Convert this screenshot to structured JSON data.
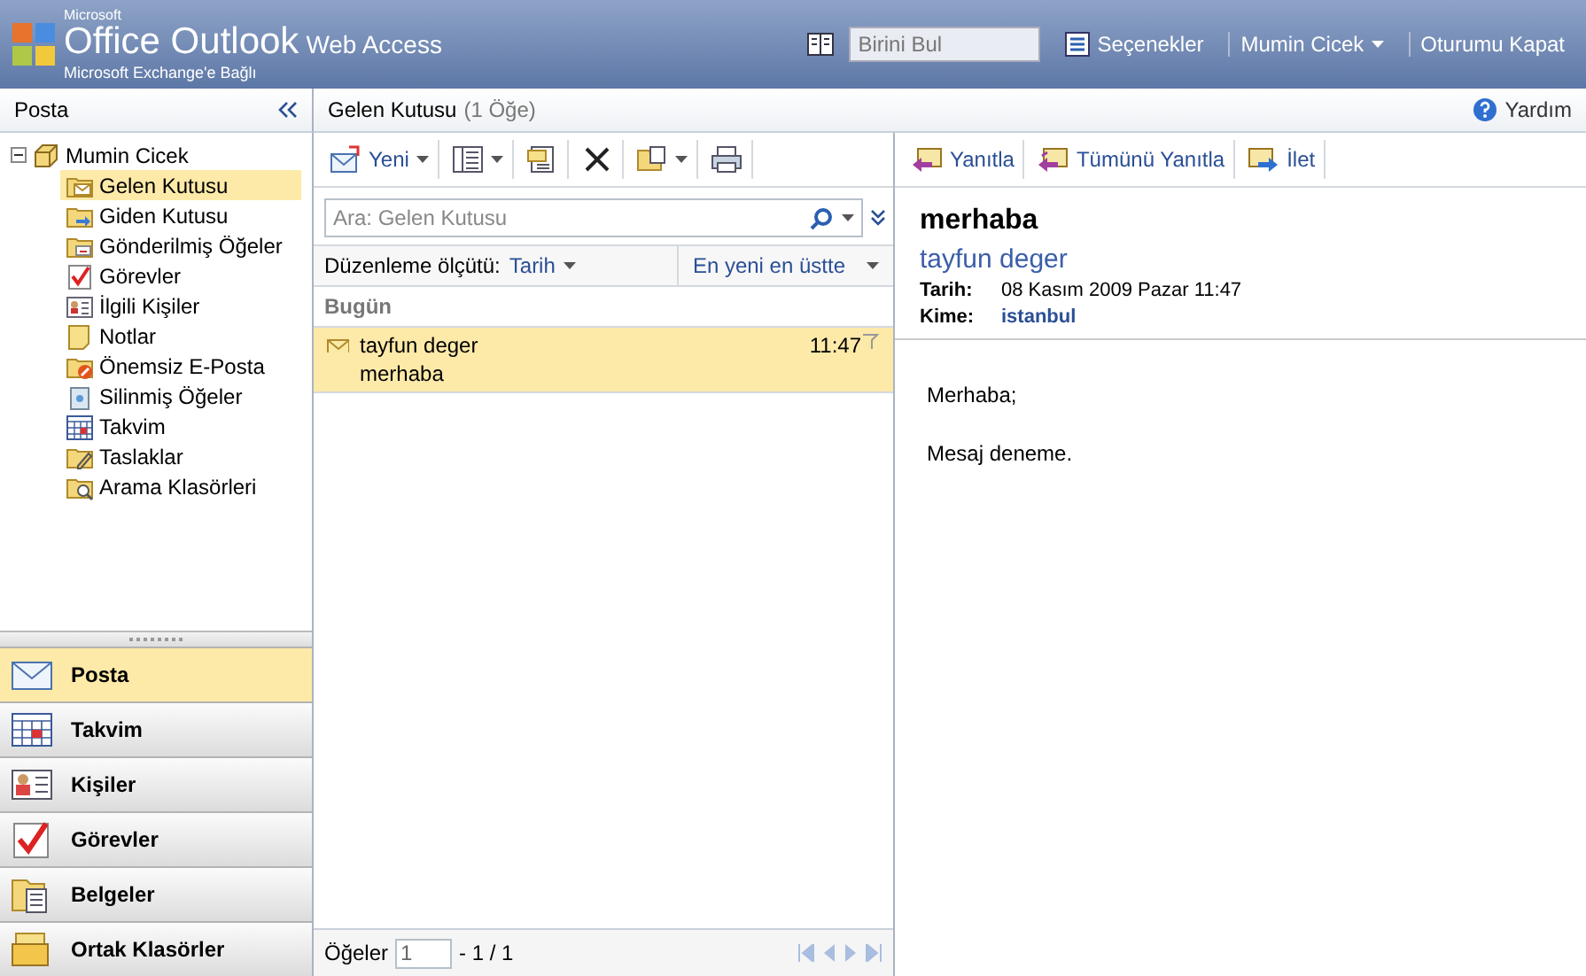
{
  "header": {
    "brand_small": "Microsoft",
    "brand": "Office Outlook",
    "brand_suffix": "Web Access",
    "subtitle": "Microsoft Exchange'e Bağlı",
    "find_placeholder": "Birini Bul",
    "options": "Seçenekler",
    "user": "Mumin Cicek",
    "logout": "Oturumu Kapat"
  },
  "sidebar": {
    "title": "Posta",
    "tree": {
      "label": "Mumin Cicek",
      "expanded": true,
      "children": [
        {
          "label": "Gelen Kutusu",
          "kind": "inbox",
          "selected": true
        },
        {
          "label": "Giden Kutusu",
          "kind": "outbox",
          "selected": false
        },
        {
          "label": "Gönderilmiş Öğeler",
          "kind": "sent",
          "selected": false
        },
        {
          "label": "Görevler",
          "kind": "tasks",
          "selected": false
        },
        {
          "label": "İlgili Kişiler",
          "kind": "contacts",
          "selected": false
        },
        {
          "label": "Notlar",
          "kind": "notes",
          "selected": false
        },
        {
          "label": "Önemsiz E-Posta",
          "kind": "junk",
          "selected": false
        },
        {
          "label": "Silinmiş Öğeler",
          "kind": "deleted",
          "selected": false
        },
        {
          "label": "Takvim",
          "kind": "calendar",
          "selected": false
        },
        {
          "label": "Taslaklar",
          "kind": "drafts",
          "selected": false
        },
        {
          "label": "Arama Klasörleri",
          "kind": "search",
          "selected": false
        }
      ]
    },
    "nav_buttons": [
      {
        "label": "Posta",
        "kind": "mail",
        "selected": true
      },
      {
        "label": "Takvim",
        "kind": "calendar",
        "selected": false
      },
      {
        "label": "Kişiler",
        "kind": "contacts",
        "selected": false
      },
      {
        "label": "Görevler",
        "kind": "tasks",
        "selected": false
      },
      {
        "label": "Belgeler",
        "kind": "documents",
        "selected": false
      },
      {
        "label": "Ortak Klasörler",
        "kind": "public",
        "selected": false
      }
    ]
  },
  "message_list": {
    "title": "Gelen Kutusu",
    "count": "(1 Öğe)",
    "toolbar": [
      {
        "kind": "new",
        "label": "Yeni",
        "dropdown": true
      },
      {
        "kind": "view",
        "dropdown": true
      },
      {
        "kind": "move",
        "dropdown": false
      },
      {
        "kind": "delete",
        "dropdown": false
      },
      {
        "kind": "copy",
        "dropdown": true
      },
      {
        "kind": "print",
        "dropdown": false
      }
    ],
    "search_placeholder": "Ara: Gelen Kutusu",
    "sort_label": "Düzenleme ölçütü:",
    "sort_value": "Tarih",
    "order": "En yeni en üstte",
    "group": "Bugün",
    "messages": [
      {
        "sender": "tayfun deger",
        "subject": "merhaba",
        "time": "11:47",
        "selected": true
      }
    ],
    "footer": {
      "label": "Öğeler",
      "page": "1",
      "range": "- 1 / 1"
    }
  },
  "reading_pane": {
    "help": "Yardım",
    "toolbar": [
      {
        "kind": "reply",
        "label": "Yanıtla"
      },
      {
        "kind": "reply_all",
        "label": "Tümünü Yanıtla"
      },
      {
        "kind": "forward",
        "label": "İlet"
      }
    ],
    "subject": "merhaba",
    "sender": "tayfun deger",
    "date_label": "Tarih:",
    "date": "08 Kasım 2009 Pazar 11:47",
    "to_label": "Kime:",
    "to": "istanbul",
    "body": [
      "Merhaba;",
      "Mesaj deneme."
    ]
  }
}
